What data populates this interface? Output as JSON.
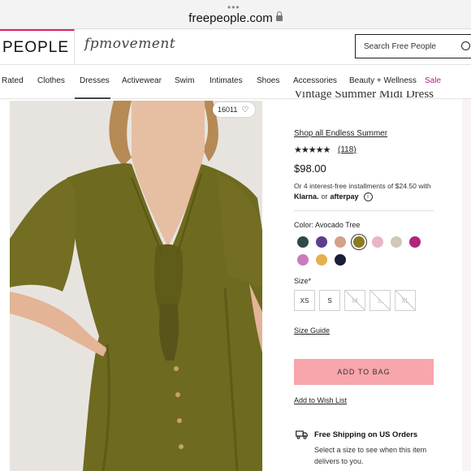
{
  "browser": {
    "url": "freepeople.com"
  },
  "header": {
    "brand": "PEOPLE",
    "sub_brand": "fpmovement",
    "search_placeholder": "Search Free People"
  },
  "nav": {
    "items": [
      {
        "label": "Rated"
      },
      {
        "label": "Clothes"
      },
      {
        "label": "Dresses"
      },
      {
        "label": "Activewear"
      },
      {
        "label": "Swim"
      },
      {
        "label": "Intimates"
      },
      {
        "label": "Shoes"
      },
      {
        "label": "Accessories"
      },
      {
        "label": "Beauty + Wellness"
      },
      {
        "label": "Sale"
      }
    ],
    "active": "Dresses"
  },
  "image": {
    "save_count": "16011",
    "dress_color": "#6e6a1f"
  },
  "product": {
    "title": "Vintage Summer Midi Dress",
    "shop_all": "Shop all Endless Summer",
    "rating": 4.5,
    "stars": "★★★★★",
    "review_count": "(118)",
    "price": "$98.00",
    "installments": "Or 4 interest-free installments of $24.50 with",
    "klarna": "Klarna.",
    "or": "or",
    "afterpay": "afterpay",
    "info_icon": "i",
    "color_label": "Color: Avocado Tree",
    "swatches": [
      {
        "color": "#2e4a45",
        "selected": false
      },
      {
        "color": "#5c3f8f",
        "selected": false
      },
      {
        "color": "#d4a18a",
        "selected": false
      },
      {
        "color": "#8e7a1f",
        "selected": true
      },
      {
        "color": "#e8b6c4",
        "selected": false
      },
      {
        "color": "#cfcab8",
        "selected": false
      },
      {
        "color": "#b0247a",
        "selected": false
      },
      {
        "color": "#c97bbf",
        "selected": false
      },
      {
        "color": "#e6b04e",
        "selected": false
      },
      {
        "color": "#1b1e38",
        "selected": false
      }
    ],
    "size_label": "Size*",
    "sizes": [
      {
        "label": "XS",
        "available": true
      },
      {
        "label": "S",
        "available": true
      },
      {
        "label": "M",
        "available": false
      },
      {
        "label": "L",
        "available": false
      },
      {
        "label": "XL",
        "available": false
      }
    ],
    "size_guide": "Size Guide",
    "add_to_bag": "ADD TO BAG",
    "wishlist": "Add to Wish List",
    "shipping_title": "Free Shipping on US Orders",
    "shipping_text": "Select a size to see when this item delivers to you."
  },
  "colors": {
    "brand_accent": "#e0245e",
    "sale": "#b0247a",
    "add_to_bag_bg": "#f8a5ab"
  }
}
